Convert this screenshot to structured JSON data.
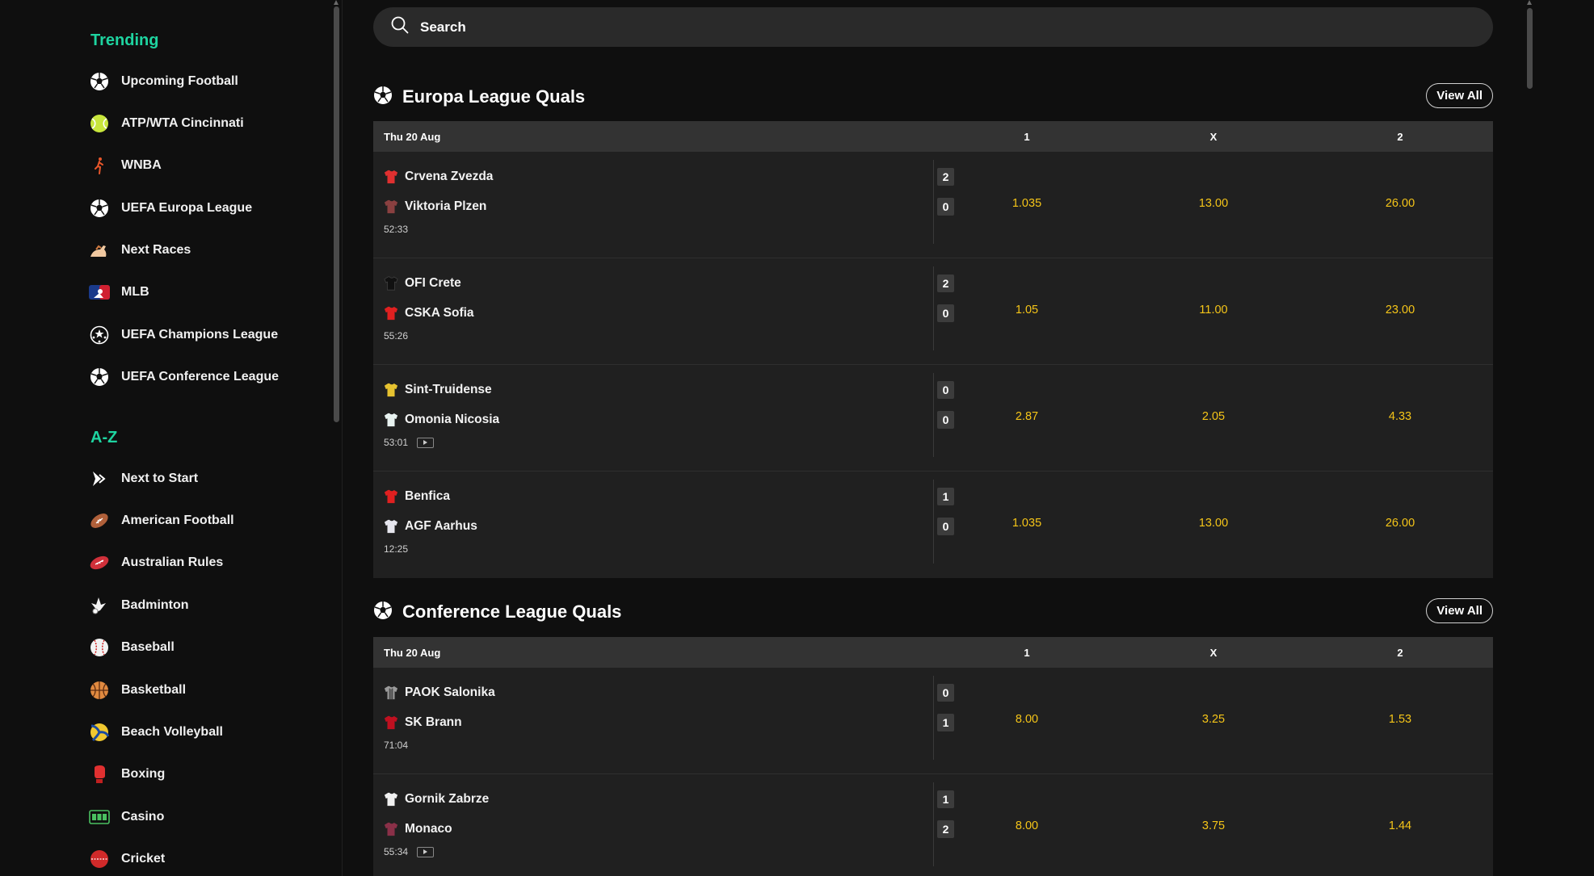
{
  "sidebar": {
    "trending_title": "Trending",
    "trending": [
      {
        "label": "Upcoming Football",
        "icon": "soccer-ball-icon"
      },
      {
        "label": "ATP/WTA Cincinnati",
        "icon": "tennis-ball-icon"
      },
      {
        "label": "WNBA",
        "icon": "wnba-logo-icon"
      },
      {
        "label": "UEFA Europa League",
        "icon": "soccer-ball-icon"
      },
      {
        "label": "Next Races",
        "icon": "horse-racing-icon"
      },
      {
        "label": "MLB",
        "icon": "mlb-logo-icon"
      },
      {
        "label": "UEFA Champions League",
        "icon": "champions-league-icon"
      },
      {
        "label": "UEFA Conference League",
        "icon": "soccer-ball-icon"
      }
    ],
    "az_title": "A-Z",
    "az": [
      {
        "label": "Next to Start",
        "icon": "next-to-start-icon"
      },
      {
        "label": "American Football",
        "icon": "american-football-icon"
      },
      {
        "label": "Australian Rules",
        "icon": "australian-rules-icon"
      },
      {
        "label": "Badminton",
        "icon": "shuttlecock-icon"
      },
      {
        "label": "Baseball",
        "icon": "baseball-icon"
      },
      {
        "label": "Basketball",
        "icon": "basketball-icon"
      },
      {
        "label": "Beach Volleyball",
        "icon": "volleyball-icon"
      },
      {
        "label": "Boxing",
        "icon": "boxing-glove-icon"
      },
      {
        "label": "Casino",
        "icon": "slot-machine-icon"
      },
      {
        "label": "Cricket",
        "icon": "cricket-ball-icon"
      }
    ]
  },
  "search": {
    "placeholder": "Search"
  },
  "sections": [
    {
      "title": "Europa League Quals",
      "view_all": "View All",
      "date": "Thu 20 Aug",
      "cols": [
        "1",
        "X",
        "2"
      ],
      "matches": [
        {
          "home": "Crvena Zvezda",
          "away": "Viktoria Plzen",
          "home_score": "2",
          "away_score": "0",
          "time": "52:33",
          "odds": [
            "1.035",
            "13.00",
            "26.00"
          ],
          "home_shirt": "#e03030",
          "away_shirt": "#8a4040"
        },
        {
          "home": "OFI Crete",
          "away": "CSKA Sofia",
          "home_score": "2",
          "away_score": "0",
          "time": "55:26",
          "odds": [
            "1.05",
            "11.00",
            "23.00"
          ],
          "home_shirt": "#111111",
          "away_shirt": "#e02020"
        },
        {
          "home": "Sint-Truidense",
          "away": "Omonia Nicosia",
          "home_score": "0",
          "away_score": "0",
          "time": "53:01",
          "odds": [
            "2.87",
            "2.05",
            "4.33"
          ],
          "home_shirt": "#e6c230",
          "away_shirt": "#e8f2f0"
        },
        {
          "home": "Benfica",
          "away": "AGF Aarhus",
          "home_score": "1",
          "away_score": "0",
          "time": "12:25",
          "odds": [
            "1.035",
            "13.00",
            "26.00"
          ],
          "home_shirt": "#e02020",
          "away_shirt": "#e6e6ee"
        }
      ]
    },
    {
      "title": "Conference League Quals",
      "view_all": "View All",
      "date": "Thu 20 Aug",
      "cols": [
        "1",
        "X",
        "2"
      ],
      "matches": [
        {
          "home": "PAOK Salonika",
          "away": "SK Brann",
          "home_score": "0",
          "away_score": "1",
          "time": "71:04",
          "odds": [
            "8.00",
            "3.25",
            "1.53"
          ],
          "home_shirt": "#9a9a9a",
          "away_shirt": "#c01020"
        },
        {
          "home": "Gornik Zabrze",
          "away": "Monaco",
          "home_score": "1",
          "away_score": "2",
          "time": "55:34",
          "odds": [
            "8.00",
            "3.75",
            "1.44"
          ],
          "home_shirt": "#f0f0f0",
          "away_shirt": "#8a3048"
        }
      ]
    }
  ]
}
